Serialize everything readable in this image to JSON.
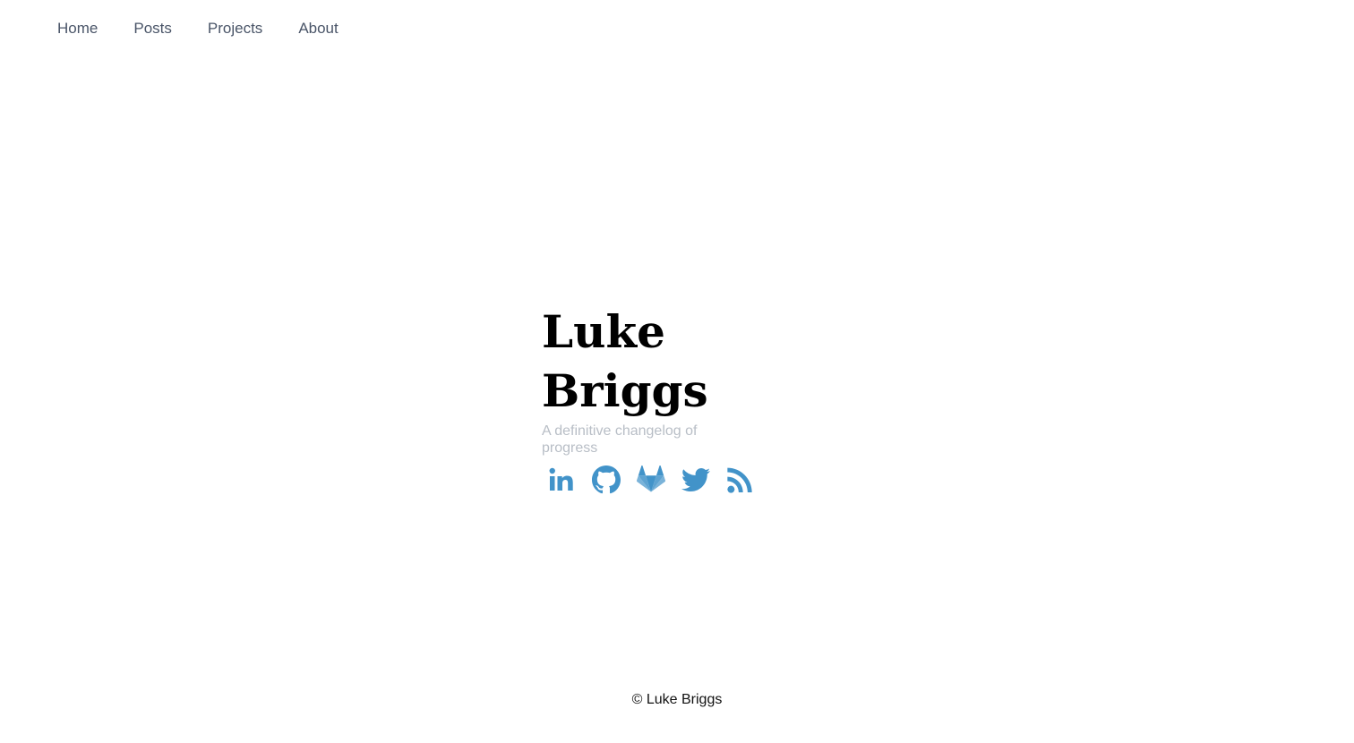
{
  "nav": {
    "items": [
      {
        "label": "Home"
      },
      {
        "label": "Posts"
      },
      {
        "label": "Projects"
      },
      {
        "label": "About"
      }
    ]
  },
  "hero": {
    "title": "Luke Briggs",
    "subtitle": "A definitive changelog of progress"
  },
  "socials": [
    {
      "icon": "linkedin-icon"
    },
    {
      "icon": "github-icon"
    },
    {
      "icon": "gitlab-icon"
    },
    {
      "icon": "twitter-icon"
    },
    {
      "icon": "rss-icon"
    }
  ],
  "footer": {
    "copyright": "© Luke Briggs"
  },
  "colors": {
    "nav_text": "#4a5568",
    "subtitle": "#b8bec6",
    "icon_accent": "#4293c9",
    "title": "#000000"
  }
}
